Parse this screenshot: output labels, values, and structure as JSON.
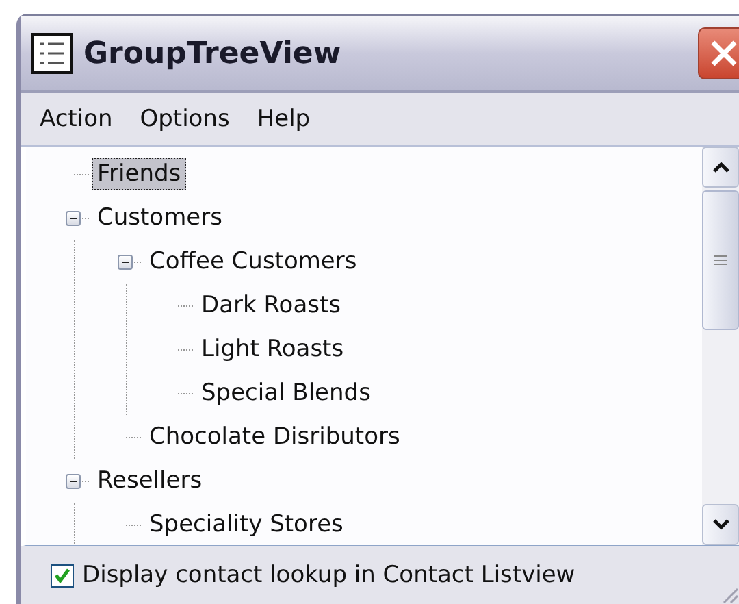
{
  "window": {
    "title": "GroupTreeView"
  },
  "menu": [
    {
      "label": "Action"
    },
    {
      "label": "Options"
    },
    {
      "label": "Help"
    }
  ],
  "tree": [
    {
      "label": "Friends",
      "selected": true
    },
    {
      "label": "Customers",
      "selected": false,
      "expanded": true,
      "children": [
        {
          "label": "Coffee Customers",
          "selected": false,
          "expanded": true,
          "children": [
            {
              "label": "Dark Roasts",
              "selected": false
            },
            {
              "label": "Light Roasts",
              "selected": false
            },
            {
              "label": "Special Blends",
              "selected": false
            }
          ]
        },
        {
          "label": "Chocolate Disributors",
          "selected": false
        }
      ]
    },
    {
      "label": "Resellers",
      "selected": false,
      "expanded": true,
      "children": [
        {
          "label": "Speciality Stores",
          "selected": false
        }
      ]
    }
  ],
  "option": {
    "label": "Display contact lookup in Contact Listview",
    "checked": true
  }
}
